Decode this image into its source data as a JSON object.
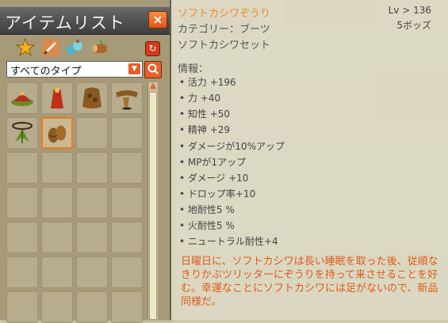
{
  "window": {
    "title": "アイテムリスト",
    "close_label": "×",
    "type_select": "すべてのタイプ",
    "categories": [
      "favorite-star-icon",
      "weapon-icon",
      "consumable-icon",
      "resource-icon"
    ],
    "refresh_icon": "refresh-icon",
    "search_icon": "search-icon"
  },
  "items": [
    {
      "name": "red-hat-icon",
      "selected": false
    },
    {
      "name": "red-cape-icon",
      "selected": false
    },
    {
      "name": "brown-cloak-icon",
      "selected": false
    },
    {
      "name": "brown-belt-icon",
      "selected": false
    },
    {
      "name": "leaf-amulet-icon",
      "selected": false
    },
    {
      "name": "soft-boots-icon",
      "selected": true
    }
  ],
  "tooltip": {
    "name": "ソフトカシワぞうり",
    "level": "Lv > 136",
    "socket": "5ボッズ",
    "category": "カテゴリー：ブーツ",
    "set": "ソフトカシワセット",
    "info_header": "情報：",
    "stats": [
      "• 活力 +196",
      "• 力 +40",
      "• 知性 +50",
      "• 精神 +29",
      "• ダメージが10%アップ",
      "• MPが1アップ",
      "• ダメージ +10",
      "• ドロップ率+10",
      "• 地耐性5 %",
      "• 火耐性5 %",
      "• ニュートラル耐性+4"
    ],
    "description": "日曜日に、ソフトカシワは長い睡眠を取った後、従順なきりかぶツリッターにぞうりを持って来させることを好む。幸運なことにソフトカシワには足がないので、新品同様だ。"
  },
  "colors": {
    "accent": "#e8602a",
    "name": "#f08a2b",
    "description": "#e05a18"
  }
}
